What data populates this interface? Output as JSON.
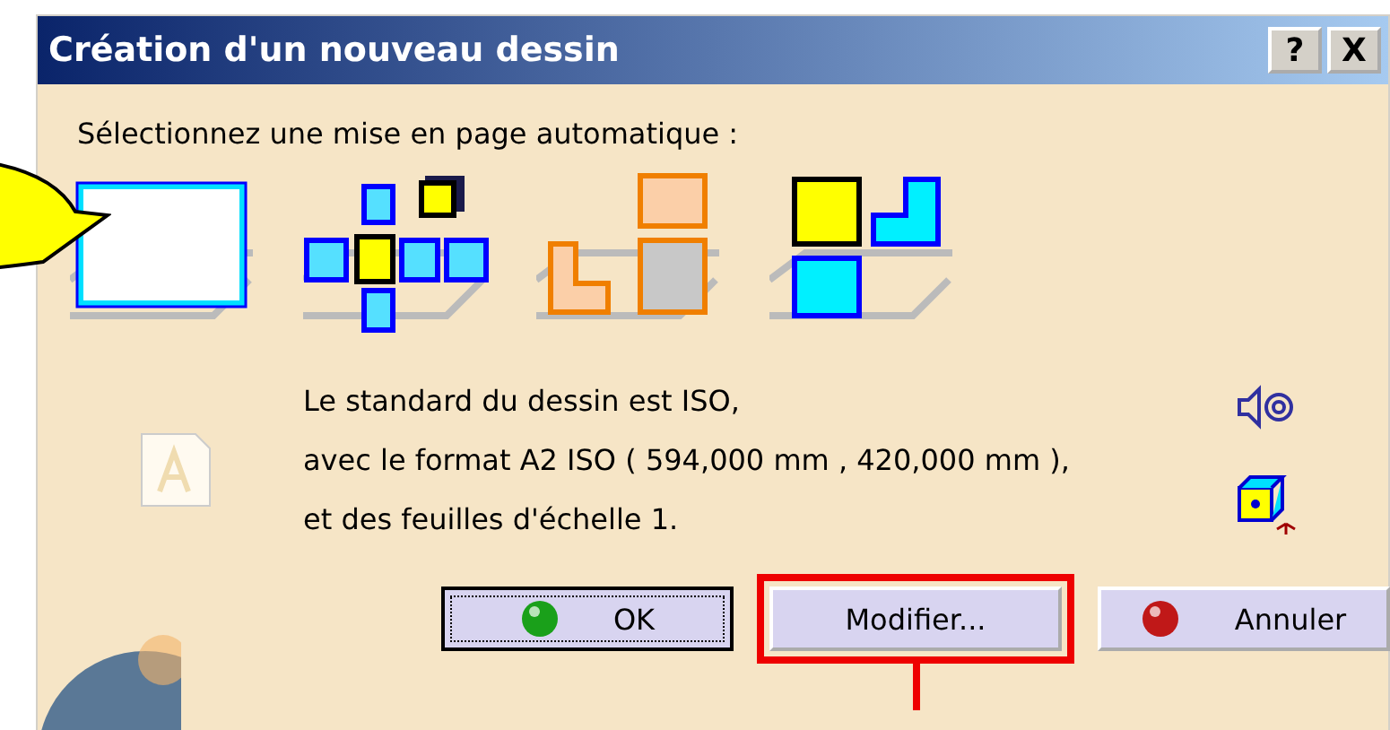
{
  "window": {
    "title": "Création d'un nouveau dessin",
    "controls": [
      "?",
      "X"
    ]
  },
  "prompt": "Sélectionnez une mise en page automatique :",
  "layouts": [
    {
      "kind": "blank",
      "selected": true
    },
    {
      "kind": "cross",
      "selected": false
    },
    {
      "kind": "corner",
      "selected": false
    },
    {
      "kind": "grid",
      "selected": false
    }
  ],
  "info": [
    "Le standard du dessin est ISO,",
    "avec le format A2 ISO ( 594,000 mm , 420,000 mm ),",
    "et des feuilles d'échelle 1."
  ],
  "buttons": [
    {
      "label": "OK",
      "kind": "ok",
      "focused": true,
      "highlighted": false
    },
    {
      "label": "Modifier...",
      "kind": "plain",
      "focused": false,
      "highlighted": true
    },
    {
      "label": "Annuler",
      "kind": "cancel",
      "focused": false,
      "highlighted": false
    }
  ]
}
